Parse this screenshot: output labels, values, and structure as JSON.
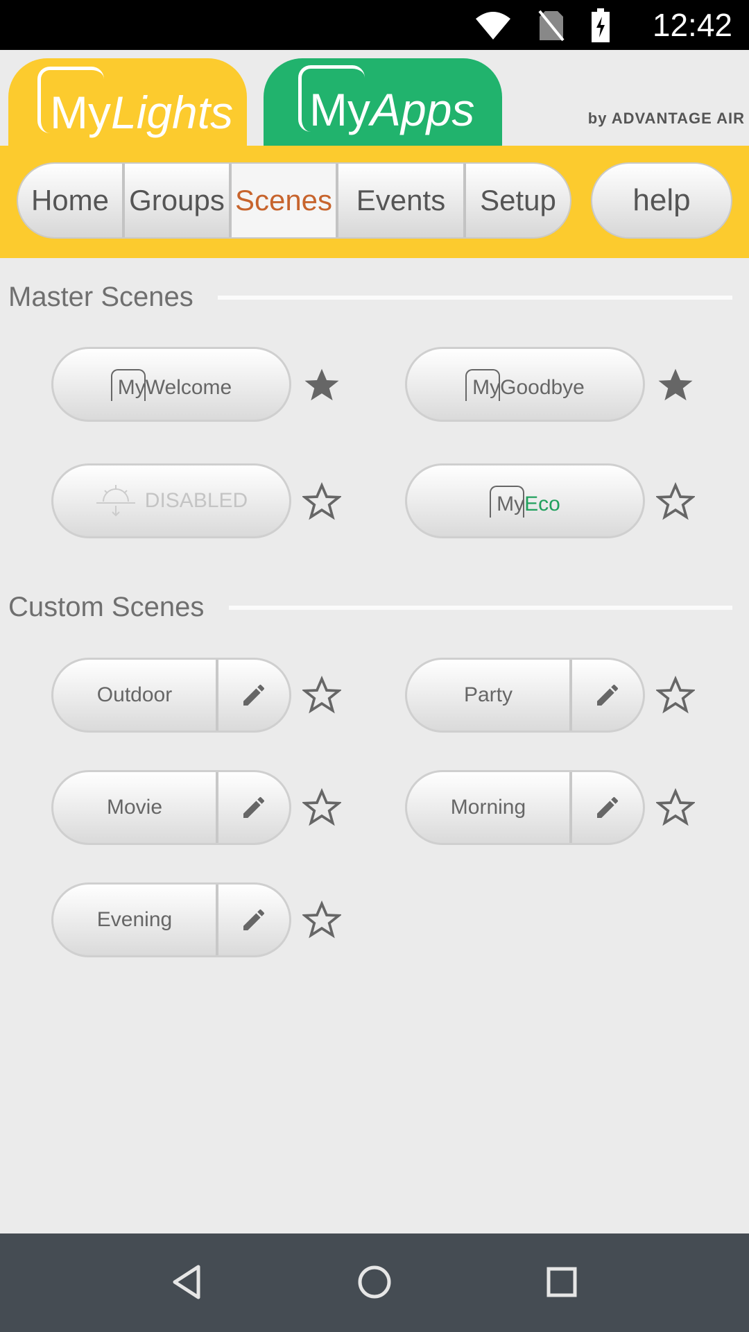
{
  "status": {
    "time": "12:42"
  },
  "header": {
    "tab_lights": {
      "my": "My",
      "word": "Lights"
    },
    "tab_apps": {
      "my": "My",
      "word": "Apps"
    },
    "brand": "by ADVANTAGE AIR"
  },
  "nav": {
    "items": [
      "Home",
      "Groups",
      "Scenes",
      "Events",
      "Setup"
    ],
    "active": "Scenes",
    "help": "help"
  },
  "master": {
    "title": "Master Scenes",
    "scenes": [
      {
        "my": "My",
        "rest": "Welcome",
        "favorite": true
      },
      {
        "my": "My",
        "rest": "Goodbye",
        "favorite": true
      },
      {
        "label": "DISABLED",
        "disabled": true,
        "favorite": false
      },
      {
        "my": "My",
        "rest": "Eco",
        "favorite": false,
        "rest_color": "#21a05d"
      }
    ]
  },
  "custom": {
    "title": "Custom Scenes",
    "scenes": [
      {
        "label": "Outdoor",
        "favorite": false
      },
      {
        "label": "Party",
        "favorite": false
      },
      {
        "label": "Movie",
        "favorite": false
      },
      {
        "label": "Morning",
        "favorite": false
      },
      {
        "label": "Evening",
        "favorite": false
      }
    ]
  },
  "colors": {
    "yellow": "#fccb2e",
    "green": "#21b36d",
    "active_tab": "#c7642d",
    "navbar": "#454c53"
  }
}
